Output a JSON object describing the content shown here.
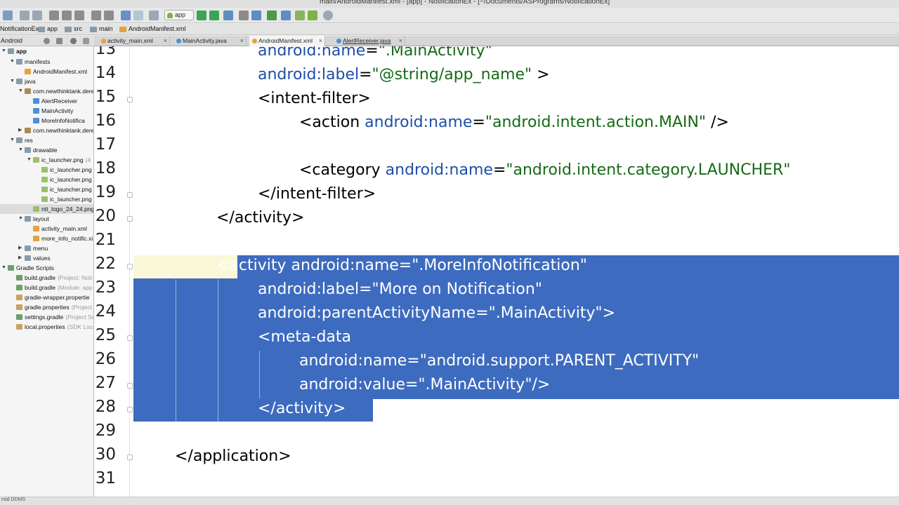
{
  "window": {
    "title": "main/AndroidManifest.xml - [app] - NotificationEx - [~/Documents/ASPrograms/NotificationEx]"
  },
  "toolbar": {
    "run_config": "app"
  },
  "breadcrumb": [
    "NotificationEx",
    "app",
    "src",
    "main",
    "AndroidManifest.xml"
  ],
  "project_panel": {
    "view_mode": "Android"
  },
  "tabs": [
    {
      "label": "activity_main.xml",
      "icon_color": "#e6a23c",
      "active": false
    },
    {
      "label": "MainActivity.java",
      "icon_color": "#4a90d9",
      "active": false
    },
    {
      "label": "AndroidManifest.xml",
      "icon_color": "#e6a23c",
      "active": true
    },
    {
      "label": "AlertReceiver.java",
      "icon_color": "#4a90d9",
      "active": false
    }
  ],
  "tree": [
    {
      "label": "app",
      "note": "",
      "arrow": "down",
      "bold": true
    },
    {
      "label": "manifests",
      "note": "",
      "arrow": "down"
    },
    {
      "label": "AndroidManifest.xml",
      "note": "",
      "arrow": ""
    },
    {
      "label": "java",
      "note": "",
      "arrow": "down"
    },
    {
      "label": "com.newthinktank.dere",
      "note": "",
      "arrow": "down"
    },
    {
      "label": "AlertReceiver",
      "note": "",
      "arrow": ""
    },
    {
      "label": "MainActivity",
      "note": "",
      "arrow": ""
    },
    {
      "label": "MoreInfoNotifica",
      "note": "",
      "arrow": ""
    },
    {
      "label": "com.newthinktank.dere",
      "note": "",
      "arrow": "right"
    },
    {
      "label": "res",
      "note": "",
      "arrow": "down"
    },
    {
      "label": "drawable",
      "note": "",
      "arrow": "down"
    },
    {
      "label": "ic_launcher.png",
      "note": "(4",
      "arrow": "down"
    },
    {
      "label": "ic_launcher.png",
      "note": "",
      "arrow": ""
    },
    {
      "label": "ic_launcher.png",
      "note": "",
      "arrow": ""
    },
    {
      "label": "ic_launcher.png",
      "note": "",
      "arrow": ""
    },
    {
      "label": "ic_launcher.png",
      "note": "",
      "arrow": ""
    },
    {
      "label": "ntt_logo_24_24.png",
      "note": "",
      "arrow": "",
      "selected": true
    },
    {
      "label": "layout",
      "note": "",
      "arrow": "down"
    },
    {
      "label": "activity_main.xml",
      "note": "",
      "arrow": ""
    },
    {
      "label": "more_info_notific.xi",
      "note": "",
      "arrow": ""
    },
    {
      "label": "menu",
      "note": "",
      "arrow": "right"
    },
    {
      "label": "values",
      "note": "",
      "arrow": "right"
    },
    {
      "label": "Gradle Scripts",
      "note": "",
      "arrow": "down"
    },
    {
      "label": "build.gradle",
      "note": "(Project: Noti",
      "arrow": ""
    },
    {
      "label": "build.gradle",
      "note": "(Module: app",
      "arrow": ""
    },
    {
      "label": "gradle-wrapper.propertie",
      "note": "",
      "arrow": ""
    },
    {
      "label": "gradle.properties",
      "note": "(Project",
      "arrow": ""
    },
    {
      "label": "settings.gradle",
      "note": "(Project Se",
      "arrow": ""
    },
    {
      "label": "local.properties",
      "note": "(SDK Loca",
      "arrow": ""
    }
  ],
  "code_lines": [
    {
      "n": "13",
      "indent": 3,
      "segments": [
        [
          "attr",
          "android:name"
        ],
        [
          "tag",
          "="
        ],
        [
          "str",
          "\".MainActivity\""
        ]
      ]
    },
    {
      "n": "14",
      "indent": 3,
      "segments": [
        [
          "attr",
          "android:label"
        ],
        [
          "tag",
          "="
        ],
        [
          "str",
          "\"@string/app_name\""
        ],
        [
          "tag",
          " >"
        ]
      ]
    },
    {
      "n": "15",
      "indent": 3,
      "segments": [
        [
          "tag",
          "<intent-filter>"
        ]
      ]
    },
    {
      "n": "16",
      "indent": 4,
      "segments": [
        [
          "tag",
          "<action "
        ],
        [
          "attr",
          "android:name"
        ],
        [
          "tag",
          "="
        ],
        [
          "str",
          "\"android.intent.action.MAIN\""
        ],
        [
          "tag",
          " />"
        ]
      ]
    },
    {
      "n": "17",
      "indent": 0,
      "segments": []
    },
    {
      "n": "18",
      "indent": 4,
      "segments": [
        [
          "tag",
          "<category "
        ],
        [
          "attr",
          "android:name"
        ],
        [
          "tag",
          "="
        ],
        [
          "str",
          "\"android.intent.category.LAUNCHER\""
        ]
      ]
    },
    {
      "n": "19",
      "indent": 3,
      "segments": [
        [
          "tag",
          "</intent-filter>"
        ]
      ]
    },
    {
      "n": "20",
      "indent": 2,
      "segments": [
        [
          "tag",
          "</activity>"
        ]
      ]
    },
    {
      "n": "21",
      "indent": 0,
      "segments": []
    },
    {
      "n": "22",
      "indent": 2,
      "segments": [
        [
          "tag",
          "<activity android:name=\".MoreInfoNotification\""
        ]
      ],
      "selected": true
    },
    {
      "n": "23",
      "indent": 3,
      "segments": [
        [
          "tag",
          "android:label=\"More on Notification\""
        ]
      ],
      "selected": true
    },
    {
      "n": "24",
      "indent": 3,
      "segments": [
        [
          "tag",
          "android:parentActivityName=\".MainActivity\">"
        ]
      ],
      "selected": true
    },
    {
      "n": "25",
      "indent": 3,
      "segments": [
        [
          "tag",
          "<meta-data"
        ]
      ],
      "selected": true
    },
    {
      "n": "26",
      "indent": 4,
      "segments": [
        [
          "tag",
          "android:name=\"android.support.PARENT_ACTIVITY\""
        ]
      ],
      "selected": true
    },
    {
      "n": "27",
      "indent": 4,
      "segments": [
        [
          "tag",
          "android:value=\".MainActivity\"/>"
        ]
      ],
      "selected": true
    },
    {
      "n": "28",
      "indent": 3,
      "segments": [
        [
          "tag",
          "</activity>"
        ]
      ],
      "selected": true
    },
    {
      "n": "29",
      "indent": 0,
      "segments": []
    },
    {
      "n": "30",
      "indent": 1,
      "segments": [
        [
          "tag",
          "</application>"
        ]
      ]
    },
    {
      "n": "31",
      "indent": 0,
      "segments": []
    }
  ],
  "status": {
    "text": "roid DDMS"
  }
}
